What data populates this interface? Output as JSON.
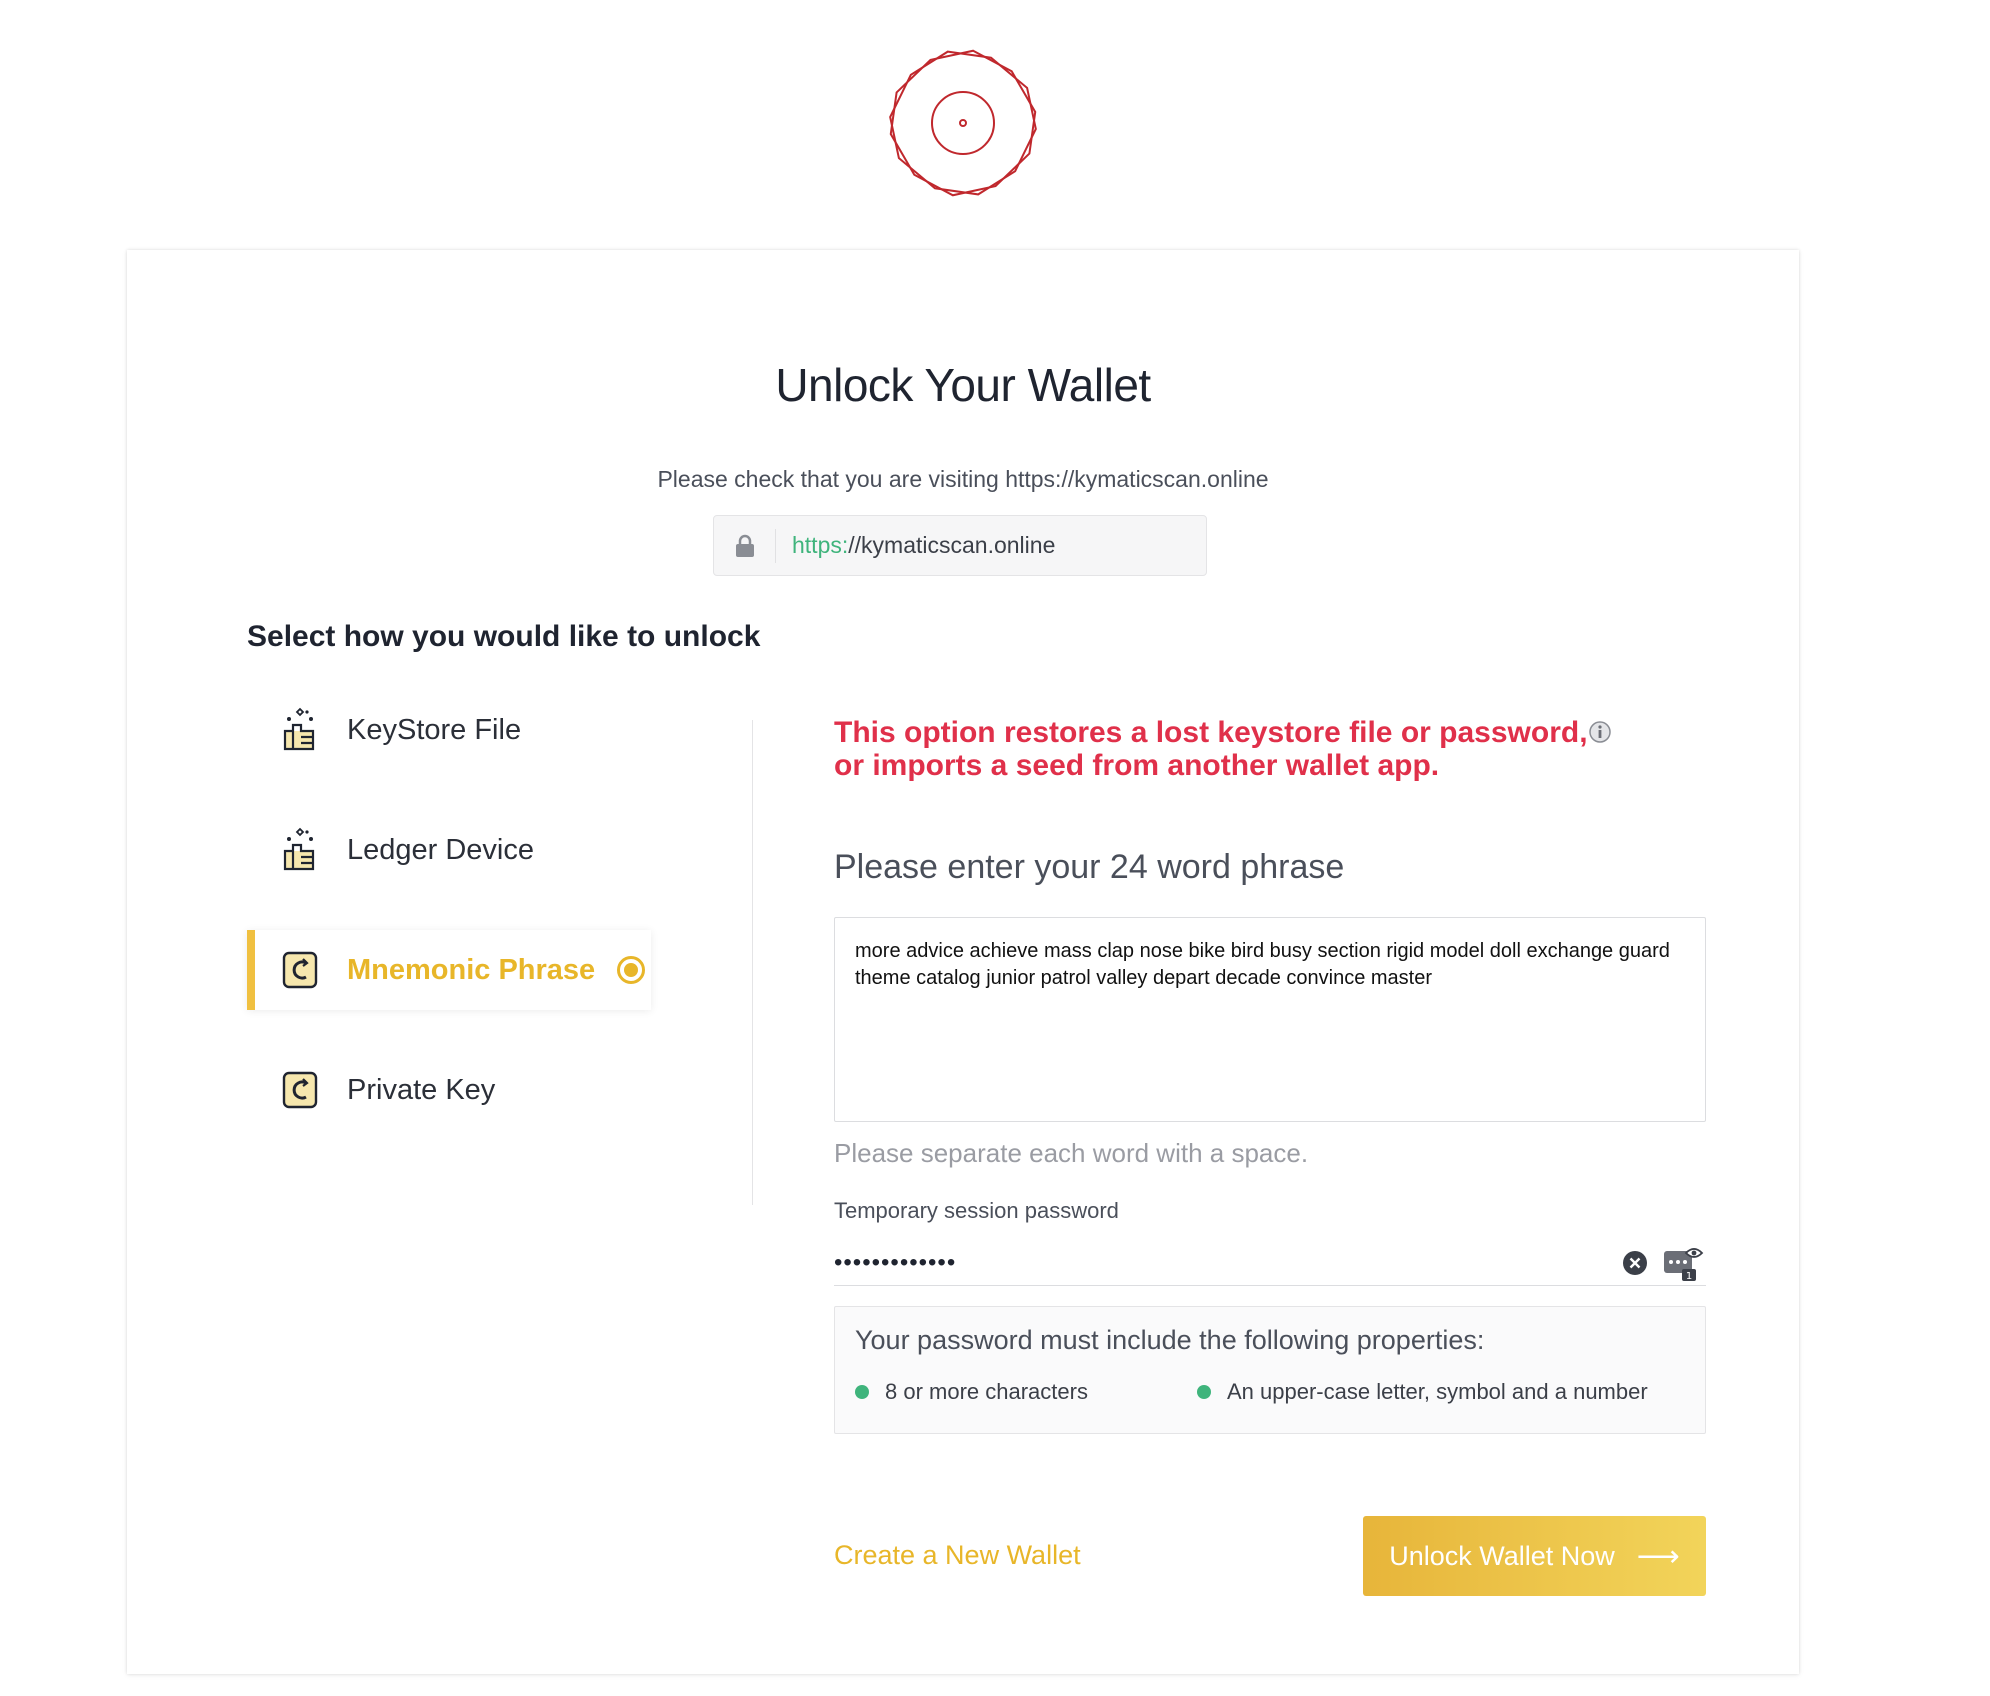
{
  "title": "Unlock Your Wallet",
  "check_text": "Please check that you are visiting https://kymaticscan.online",
  "url": {
    "scheme": "https:",
    "rest": "//kymaticscan.online"
  },
  "select_heading": "Select how you would like to unlock",
  "options": [
    {
      "label": "KeyStore File",
      "icon": "keystore-icon",
      "selected": false
    },
    {
      "label": "Ledger Device",
      "icon": "ledger-icon",
      "selected": false
    },
    {
      "label": "Mnemonic Phrase",
      "icon": "mnemonic-icon",
      "selected": true
    },
    {
      "label": "Private Key",
      "icon": "private-key-icon",
      "selected": false
    }
  ],
  "warning": {
    "line1": "This option restores a lost keystore file or password,",
    "line2": "or imports a seed from another wallet app."
  },
  "phrase": {
    "label": "Please enter your 24 word phrase",
    "value": "more advice achieve mass clap nose bike bird busy section rigid model doll exchange guard theme catalog junior patrol valley depart decade convince master",
    "hint": "Please separate each word with a space."
  },
  "password": {
    "label": "Temporary session password",
    "masked_value": "•••••••••••••"
  },
  "requirements": {
    "title": "Your password must include the following properties:",
    "items": [
      "8 or more characters",
      "An upper-case letter, symbol and a number"
    ]
  },
  "actions": {
    "create_label": "Create a New Wallet",
    "unlock_label": "Unlock Wallet Now"
  },
  "colors": {
    "accent": "#e8b629",
    "warning": "#e0304a",
    "success": "#3fb47c",
    "logo": "#c0282d"
  }
}
